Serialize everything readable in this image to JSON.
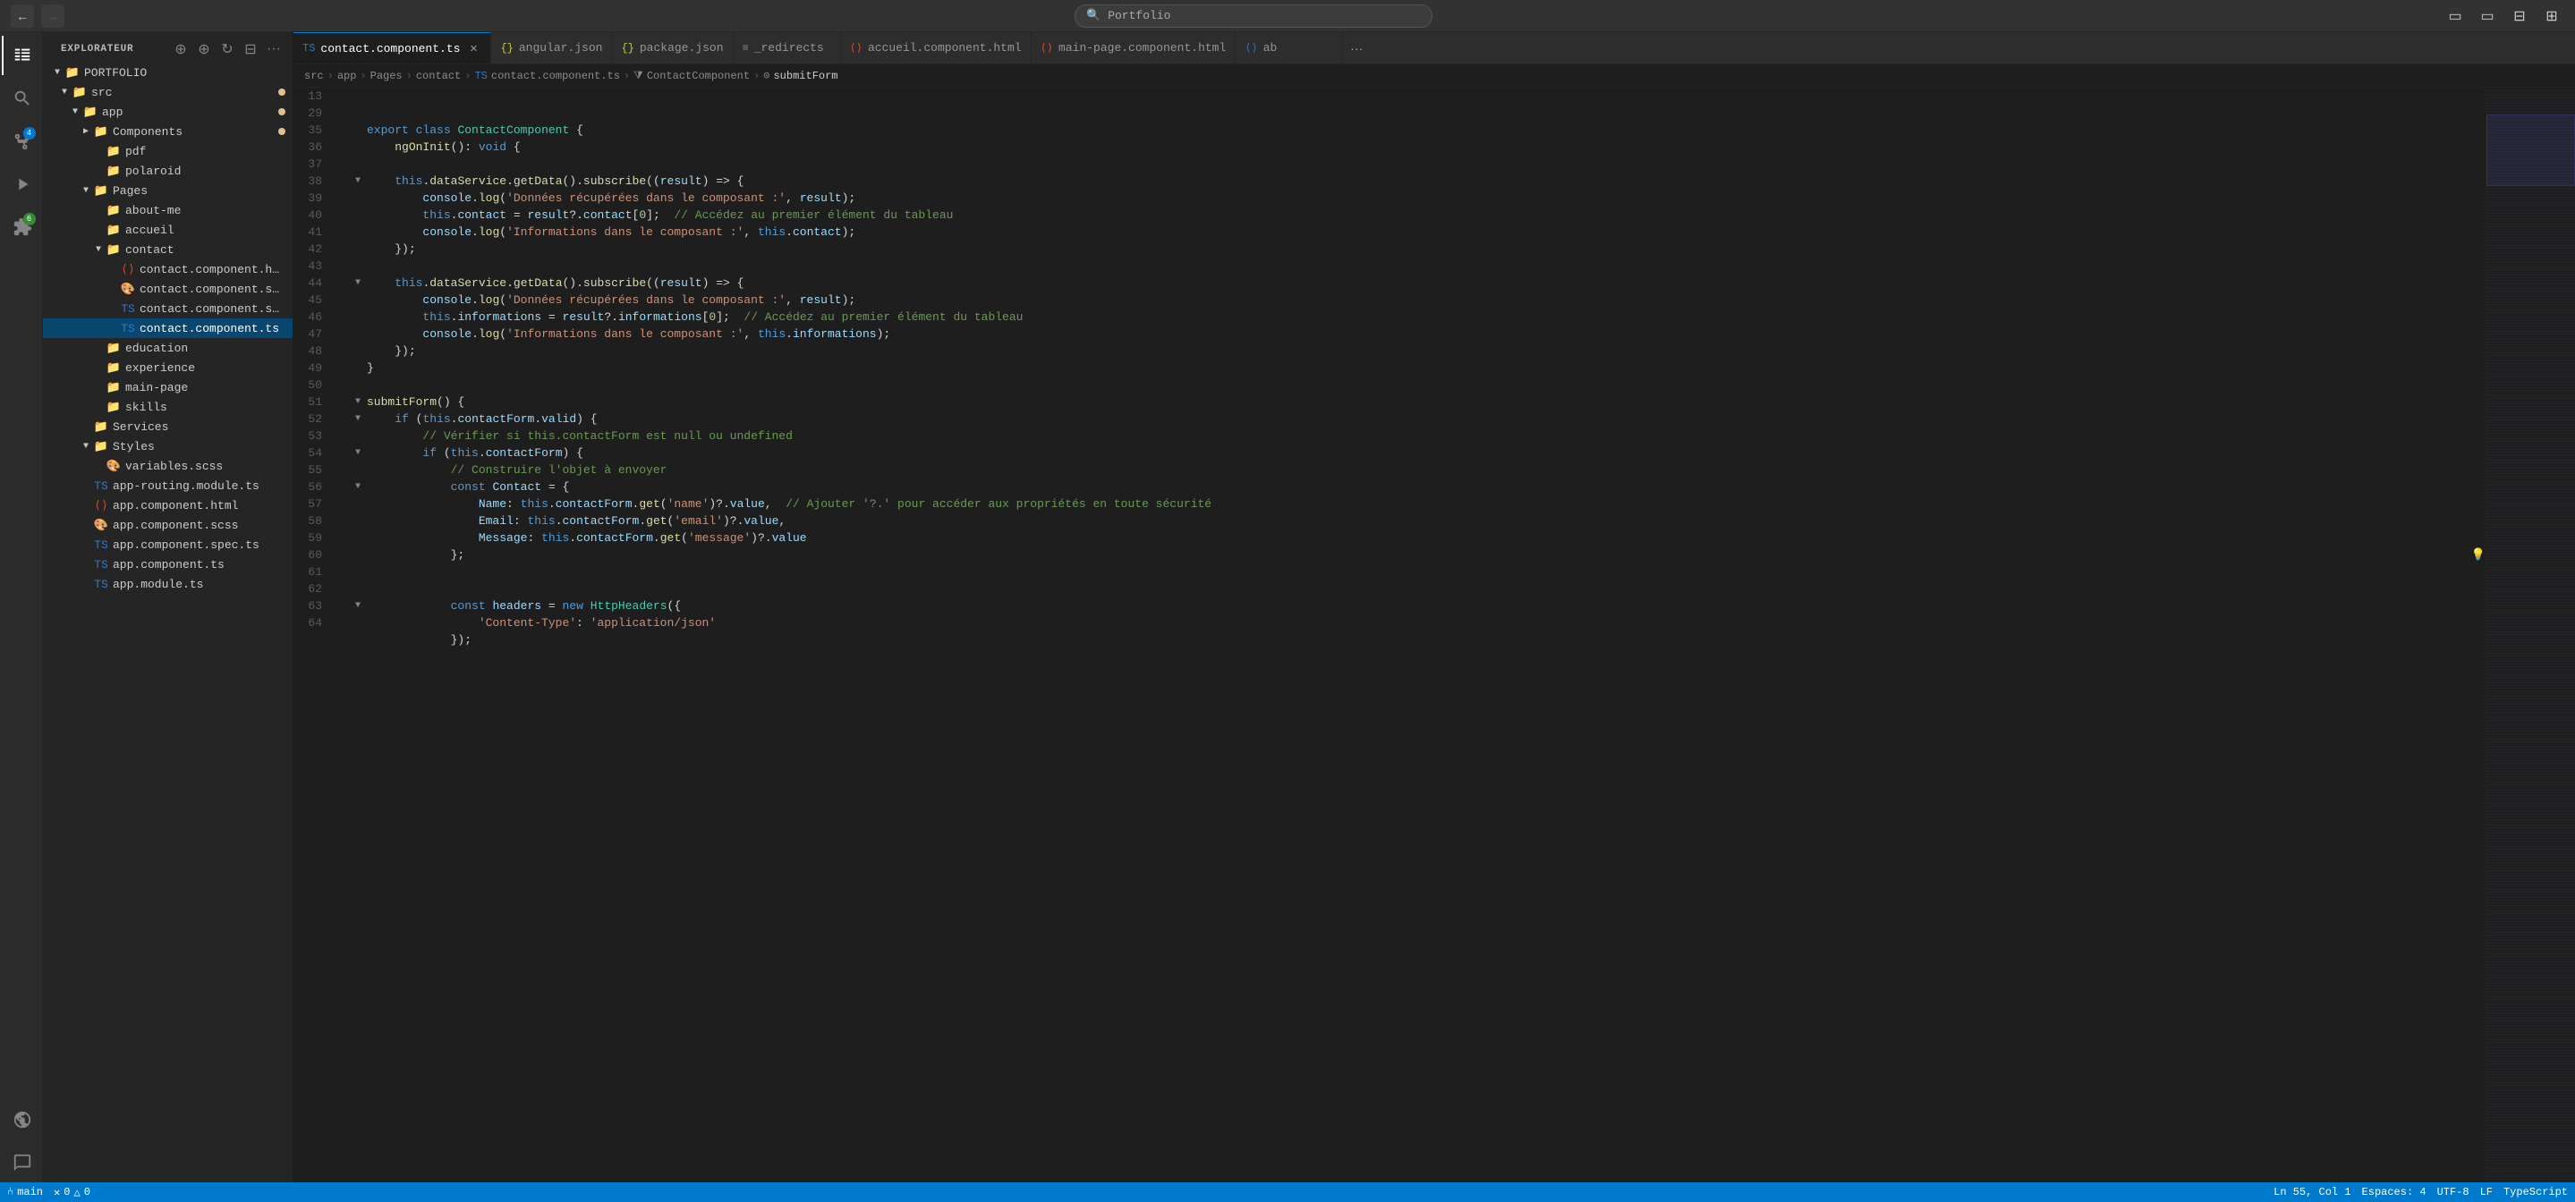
{
  "titlebar": {
    "back_label": "←",
    "forward_label": "→",
    "search_placeholder": "Portfolio",
    "win_buttons": [
      "□□",
      "□",
      "□□"
    ]
  },
  "activity_bar": {
    "items": [
      {
        "name": "explorer",
        "icon": "🗂",
        "active": true
      },
      {
        "name": "search",
        "icon": "🔍",
        "active": false
      },
      {
        "name": "source-control",
        "icon": "⑃",
        "active": false,
        "badge": "4",
        "badge_color": "blue"
      },
      {
        "name": "run-debug",
        "icon": "▷",
        "active": false
      },
      {
        "name": "extensions",
        "icon": "⊞",
        "active": false,
        "badge": "6",
        "badge_color": "green"
      },
      {
        "name": "remote",
        "icon": "◎",
        "active": false
      },
      {
        "name": "chat",
        "icon": "💬",
        "active": false
      }
    ]
  },
  "sidebar": {
    "title": "EXPLORATEUR",
    "root": "PORTFOLIO",
    "tree": [
      {
        "id": "src",
        "label": "src",
        "indent": 1,
        "type": "folder",
        "expanded": true,
        "dot": "yellow"
      },
      {
        "id": "app",
        "label": "app",
        "indent": 2,
        "type": "folder",
        "expanded": true,
        "dot": "yellow"
      },
      {
        "id": "components",
        "label": "Components",
        "indent": 3,
        "type": "folder",
        "expanded": false,
        "dot": "yellow"
      },
      {
        "id": "pdf",
        "label": "pdf",
        "indent": 4,
        "type": "folder",
        "expanded": false,
        "dot": ""
      },
      {
        "id": "polaroid",
        "label": "polaroid",
        "indent": 4,
        "type": "folder",
        "expanded": false,
        "dot": ""
      },
      {
        "id": "pages",
        "label": "Pages",
        "indent": 3,
        "type": "folder",
        "expanded": true,
        "dot": ""
      },
      {
        "id": "about-me",
        "label": "about-me",
        "indent": 4,
        "type": "folder",
        "expanded": false,
        "dot": ""
      },
      {
        "id": "accueil",
        "label": "accueil",
        "indent": 4,
        "type": "folder",
        "expanded": false,
        "dot": ""
      },
      {
        "id": "contact",
        "label": "contact",
        "indent": 4,
        "type": "folder",
        "expanded": true,
        "dot": ""
      },
      {
        "id": "contact-html",
        "label": "contact.component.html",
        "indent": 5,
        "type": "file-html",
        "expanded": false,
        "dot": ""
      },
      {
        "id": "contact-scss",
        "label": "contact.component.scss",
        "indent": 5,
        "type": "file-scss",
        "expanded": false,
        "dot": ""
      },
      {
        "id": "contact-spec",
        "label": "contact.component.spec.ts",
        "indent": 5,
        "type": "file-ts",
        "expanded": false,
        "dot": ""
      },
      {
        "id": "contact-ts",
        "label": "contact.component.ts",
        "indent": 5,
        "type": "file-ts",
        "expanded": false,
        "dot": "",
        "active": true
      },
      {
        "id": "education",
        "label": "education",
        "indent": 4,
        "type": "folder",
        "expanded": false,
        "dot": ""
      },
      {
        "id": "experience",
        "label": "experience",
        "indent": 4,
        "type": "folder",
        "expanded": false,
        "dot": ""
      },
      {
        "id": "main-page",
        "label": "main-page",
        "indent": 4,
        "type": "folder",
        "expanded": false,
        "dot": ""
      },
      {
        "id": "skills",
        "label": "skills",
        "indent": 4,
        "type": "folder",
        "expanded": false,
        "dot": ""
      },
      {
        "id": "services",
        "label": "Services",
        "indent": 3,
        "type": "folder",
        "expanded": false,
        "dot": ""
      },
      {
        "id": "styles",
        "label": "Styles",
        "indent": 3,
        "type": "folder",
        "expanded": true,
        "dot": ""
      },
      {
        "id": "variables-scss",
        "label": "variables.scss",
        "indent": 4,
        "type": "file-scss",
        "expanded": false,
        "dot": ""
      },
      {
        "id": "app-routing",
        "label": "app-routing.module.ts",
        "indent": 3,
        "type": "file-ts",
        "expanded": false,
        "dot": ""
      },
      {
        "id": "app-component-html",
        "label": "app.component.html",
        "indent": 3,
        "type": "file-html",
        "expanded": false,
        "dot": ""
      },
      {
        "id": "app-component-scss",
        "label": "app.component.scss",
        "indent": 3,
        "type": "file-scss",
        "expanded": false,
        "dot": ""
      },
      {
        "id": "app-component-spec",
        "label": "app.component.spec.ts",
        "indent": 3,
        "type": "file-ts",
        "expanded": false,
        "dot": ""
      },
      {
        "id": "app-component-ts",
        "label": "app.component.ts",
        "indent": 3,
        "type": "file-ts",
        "expanded": false,
        "dot": ""
      },
      {
        "id": "app-module",
        "label": "app.module.ts",
        "indent": 3,
        "type": "file-ts",
        "expanded": false,
        "dot": ""
      }
    ]
  },
  "tabs": [
    {
      "id": "contact-ts",
      "label": "contact.component.ts",
      "type": "ts",
      "active": true,
      "closable": true
    },
    {
      "id": "angular-json",
      "label": "angular.json",
      "type": "json",
      "active": false,
      "closable": false
    },
    {
      "id": "package-json",
      "label": "package.json",
      "type": "json",
      "active": false,
      "closable": false
    },
    {
      "id": "redirects",
      "label": "_redirects",
      "type": "redirects",
      "active": false,
      "closable": false
    },
    {
      "id": "accueil-html",
      "label": "accueil.component.html",
      "type": "html",
      "active": false,
      "closable": false
    },
    {
      "id": "main-page-html",
      "label": "main-page.component.html",
      "type": "html",
      "active": false,
      "closable": false
    },
    {
      "id": "ab",
      "label": "ab",
      "type": "ts",
      "active": false,
      "closable": false
    }
  ],
  "breadcrumb": {
    "parts": [
      "src",
      "app",
      "Pages",
      "contact",
      "contact.component.ts",
      "ContactComponent",
      "submitForm"
    ]
  },
  "code": {
    "lines": [
      {
        "num": 13,
        "fold": "",
        "content": "<kw>export</kw> <kw>class</kw> <cls>ContactComponent</cls> {"
      },
      {
        "num": 29,
        "fold": "",
        "content": "    <fn>ngOnInit</fn><punc>():</punc> <kw>void</kw> {"
      },
      {
        "num": 35,
        "fold": "",
        "content": ""
      },
      {
        "num": 36,
        "fold": "open",
        "content": "    <kw2>this</kw2><op>.</op><fn>dataService</fn><op>.</op><fn>getData</fn><punc>()</punc><op>.</op><fn>subscribe</fn><punc>((</punc><var>result</var><punc>)</punc> <op>=></op> {"
      },
      {
        "num": 37,
        "fold": "",
        "content": "        <var>console</var><op>.</op><fn>log</fn><punc>(</punc><str>'Données récupérées dans le composant :'</str><punc>,</punc> <var>result</var><punc>);</punc>"
      },
      {
        "num": 38,
        "fold": "",
        "content": "        <kw2>this</kw2><op>.</op><var>contact</var> <op>=</op> <var>result</var><op>?.</op><var>contact</var><punc>[</punc><num>0</num><punc>];</punc>  <cmt>// Accédez au premier élément du tableau</cmt>"
      },
      {
        "num": 39,
        "fold": "",
        "content": "        <var>console</var><op>.</op><fn>log</fn><punc>(</punc><str>'Informations dans le composant :'</str><punc>,</punc> <kw2>this</kw2><op>.</op><var>contact</var><punc>);</punc>"
      },
      {
        "num": 40,
        "fold": "",
        "content": "    <punc>});</punc>"
      },
      {
        "num": 41,
        "fold": "",
        "content": ""
      },
      {
        "num": 42,
        "fold": "open",
        "content": "    <kw2>this</kw2><op>.</op><fn>dataService</fn><op>.</op><fn>getData</fn><punc>()</punc><op>.</op><fn>subscribe</fn><punc>((</punc><var>result</var><punc>)</punc> <op>=></op> {"
      },
      {
        "num": 43,
        "fold": "",
        "content": "        <var>console</var><op>.</op><fn>log</fn><punc>(</punc><str>'Données récupérées dans le composant :'</str><punc>,</punc> <var>result</var><punc>);</punc>"
      },
      {
        "num": 44,
        "fold": "",
        "content": "        <kw2>this</kw2><op>.</op><var>informations</var> <op>=</op> <var>result</var><op>?.</op><var>informations</var><punc>[</punc><num>0</num><punc>];</punc>  <cmt>// Accédez au premier élément du tableau</cmt>"
      },
      {
        "num": 45,
        "fold": "",
        "content": "        <var>console</var><op>.</op><fn>log</fn><punc>(</punc><str>'Informations dans le composant :'</str><punc>,</punc> <kw2>this</kw2><op>.</op><var>informations</var><punc>);</punc>"
      },
      {
        "num": 46,
        "fold": "",
        "content": "    <punc>});</punc>"
      },
      {
        "num": 47,
        "fold": "",
        "content": "<punc>}</punc>"
      },
      {
        "num": 48,
        "fold": "",
        "content": ""
      },
      {
        "num": 49,
        "fold": "open",
        "content": "<fn>submitForm</fn><punc>()</punc> {"
      },
      {
        "num": 50,
        "fold": "open",
        "content": "    <kw2>if</kw2> <punc>(</punc><kw2>this</kw2><op>.</op><var>contactForm</var><op>.</op><var>valid</var><punc>)</punc> {"
      },
      {
        "num": 51,
        "fold": "",
        "content": "        <cmt>// Vérifier si this.contactForm est null ou undefined</cmt>"
      },
      {
        "num": 52,
        "fold": "open",
        "content": "        <kw2>if</kw2> <punc>(</punc><kw2>this</kw2><op>.</op><var>contactForm</var><punc>)</punc> {"
      },
      {
        "num": 53,
        "fold": "",
        "content": "            <cmt>// Construire l'objet à envoyer</cmt>"
      },
      {
        "num": 54,
        "fold": "open",
        "content": "            <kw>const</kw> <var>Contact</var> <op>=</op> {"
      },
      {
        "num": 55,
        "fold": "",
        "content": "                <var>Name</var><op>:</op> <kw2>this</kw2><op>.</op><var>contactForm</var><op>.</op><fn>get</fn><punc>(</punc><str>'name'</str><punc>)?.</punc><var>value</var><punc>,</punc>  <cmt>// Ajouter '?.' pour accéder aux propriétés en toute sécurité</cmt>"
      },
      {
        "num": 56,
        "fold": "",
        "content": "                <var>Email</var><op>:</op> <kw2>this</kw2><op>.</op><var>contactForm</var><op>.</op><fn>get</fn><punc>(</punc><str>'email'</str><punc>)?.</punc><var>value</var><punc>,</punc>"
      },
      {
        "num": 57,
        "fold": "",
        "content": "                <var>Message</var><op>:</op> <kw2>this</kw2><op>.</op><var>contactForm</var><op>.</op><fn>get</fn><punc>(</punc><str>'message'</str><punc>)?.</punc><var>value</var>"
      },
      {
        "num": 58,
        "fold": "",
        "content": "            <punc>};</punc>",
        "lightbulb": true
      },
      {
        "num": 59,
        "fold": "",
        "content": ""
      },
      {
        "num": 60,
        "fold": "",
        "content": ""
      },
      {
        "num": 61,
        "fold": "open",
        "content": "            <kw>const</kw> <var>headers</var> <op>=</op> <kw>new</kw> <cls>HttpHeaders</cls><punc>({</punc>"
      },
      {
        "num": 62,
        "fold": "",
        "content": "                <str>'Content-Type'</str><op>:</op> <str>'application/json'</str>"
      },
      {
        "num": 63,
        "fold": "",
        "content": "            <punc>});</punc>"
      },
      {
        "num": 64,
        "fold": "",
        "content": ""
      }
    ]
  },
  "status_bar": {
    "branch": "main",
    "errors": "0",
    "warnings": "0",
    "language": "TypeScript",
    "encoding": "UTF-8",
    "line_ending": "LF",
    "indent": "Espaces: 4",
    "position": "Ln 55, Col 1"
  }
}
